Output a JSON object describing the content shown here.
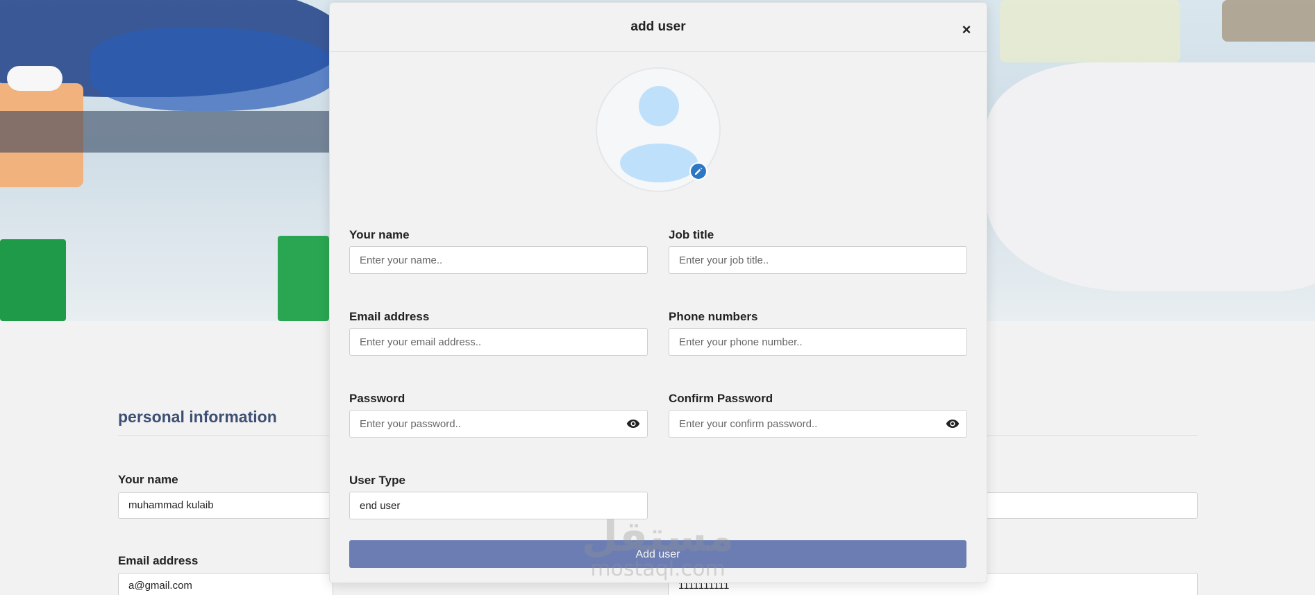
{
  "modal": {
    "title": "add user",
    "close_symbol": "×",
    "avatar_icon": "user-avatar-icon",
    "edit_icon": "pencil-icon",
    "fields": {
      "name": {
        "label": "Your name",
        "placeholder": "Enter your name.."
      },
      "job_title": {
        "label": "Job title",
        "placeholder": "Enter your job title.."
      },
      "email": {
        "label": "Email address",
        "placeholder": "Enter your email address.."
      },
      "phone": {
        "label": "Phone numbers",
        "placeholder": "Enter your phone number.."
      },
      "password": {
        "label": "Password",
        "placeholder": "Enter your password.."
      },
      "confirm_password": {
        "label": "Confirm Password",
        "placeholder": "Enter your confirm password.."
      },
      "user_type": {
        "label": "User Type",
        "value": "end user"
      }
    },
    "submit_label": "Add user",
    "accent_color": "#6b7db3"
  },
  "background_page": {
    "section_title": "personal information",
    "name_label": "Your name",
    "name_value": "muhammad kulaib",
    "email_label": "Email address",
    "email_value": "a@gmail.com",
    "phone_value": "1111111111"
  },
  "watermark": {
    "arabic": "مستقل",
    "latin": "mostaql.com"
  }
}
